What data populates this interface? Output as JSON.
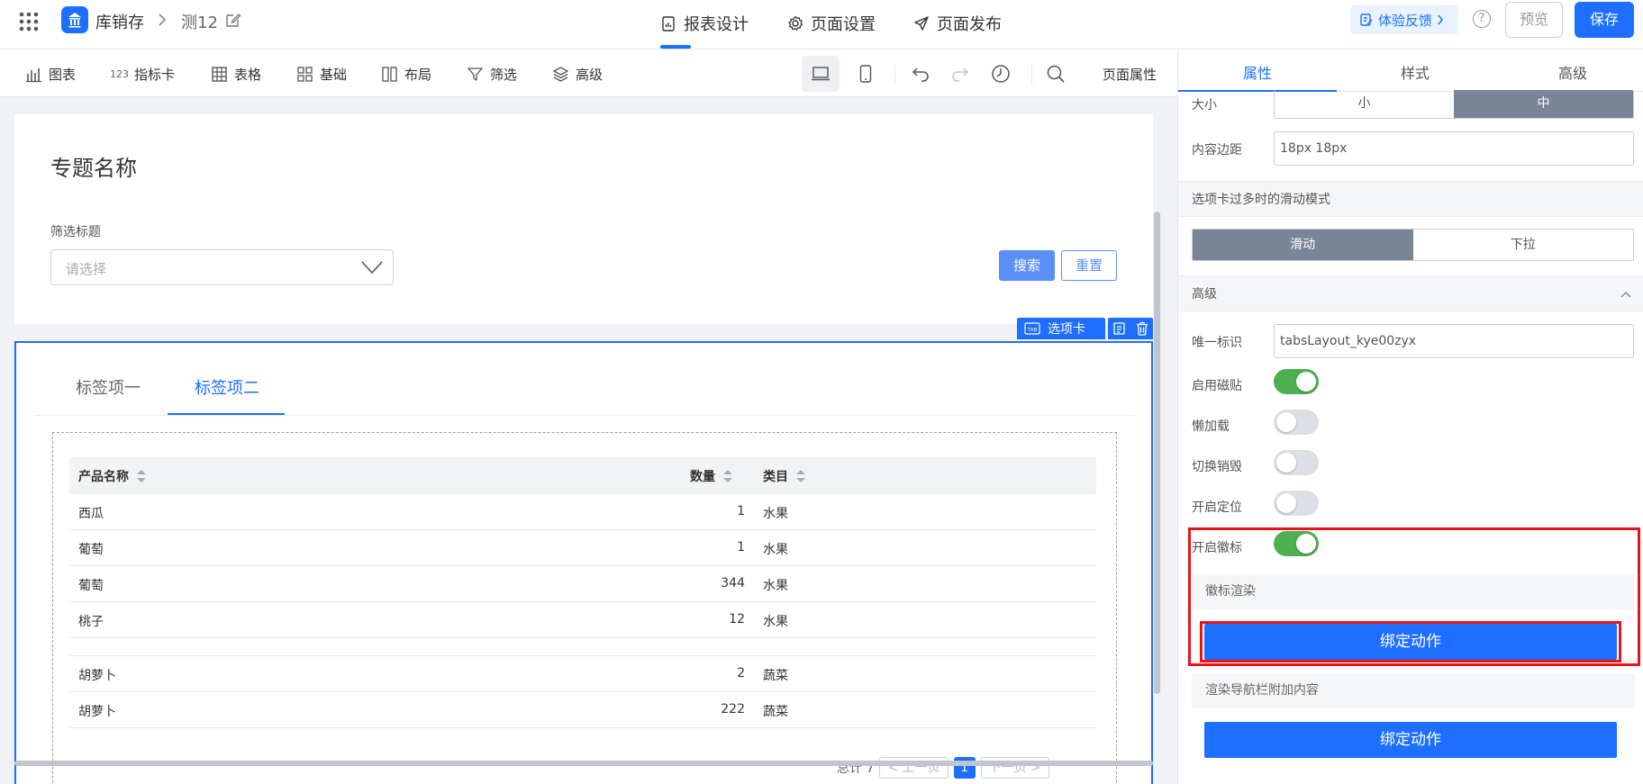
{
  "header": {
    "app_name": "库销存",
    "page_name": "测12",
    "tabs": [
      {
        "label": "报表设计",
        "icon": "report-icon",
        "active": true
      },
      {
        "label": "页面设置",
        "icon": "gear-icon",
        "active": false
      },
      {
        "label": "页面发布",
        "icon": "send-icon",
        "active": false
      }
    ],
    "feedback": "体验反馈",
    "help": "?",
    "preview": "预览",
    "save": "保存",
    "accent": "#1e6fff"
  },
  "toolbar": {
    "items": [
      {
        "label": "图表",
        "icon": "bar-chart-icon"
      },
      {
        "label": "指标卡",
        "icon": "metric-icon"
      },
      {
        "label": "表格",
        "icon": "table-icon"
      },
      {
        "label": "基础",
        "icon": "grid-icon"
      },
      {
        "label": "布局",
        "icon": "layout-icon"
      },
      {
        "label": "筛选",
        "icon": "filter-icon"
      },
      {
        "label": "高级",
        "icon": "layers-icon"
      }
    ],
    "metric_prefix": "123",
    "page_props": "页面属性"
  },
  "canvas": {
    "subject_title": "专题名称",
    "filter_label": "筛选标题",
    "select_placeholder": "请选择",
    "search": "搜索",
    "reset": "重置",
    "tabs_tag": "选项卡",
    "tab_tag_icon": "TAB",
    "tabs": [
      {
        "label": "标签项一",
        "active": false
      },
      {
        "label": "标签项二",
        "active": true
      }
    ],
    "table": {
      "columns": [
        "产品名称",
        "数量",
        "类目"
      ],
      "rows": [
        {
          "name": "西瓜",
          "qty": "1",
          "cat": "水果"
        },
        {
          "name": "葡萄",
          "qty": "1",
          "cat": "水果"
        },
        {
          "name": "葡萄",
          "qty": "344",
          "cat": "水果"
        },
        {
          "name": "桃子",
          "qty": "12",
          "cat": "水果"
        },
        {
          "name": "",
          "qty": "",
          "cat": ""
        },
        {
          "name": "胡萝卜",
          "qty": "2",
          "cat": "蔬菜"
        },
        {
          "name": "胡萝卜",
          "qty": "222",
          "cat": "蔬菜"
        }
      ]
    },
    "pager": {
      "total": "总计 7",
      "prev": "< 上一页",
      "current": "1",
      "next": "下一页 >"
    }
  },
  "rpanel": {
    "tabs": [
      "属性",
      "样式",
      "高级"
    ],
    "size_label": "大小",
    "size_options": [
      "小",
      "中"
    ],
    "padding_label": "内容边距",
    "padding_value": "18px 18px",
    "overflow_section": "选项卡过多时的滑动模式",
    "overflow_options": [
      "滑动",
      "下拉"
    ],
    "advanced_section": "高级",
    "uid_label": "唯一标识",
    "uid_value": "tabsLayout_kye00zyx",
    "toggles": [
      {
        "label": "启用磁贴",
        "on": true
      },
      {
        "label": "懒加载",
        "on": false
      },
      {
        "label": "切换销毁",
        "on": false
      },
      {
        "label": "开启定位",
        "on": false
      },
      {
        "label": "开启徽标",
        "on": true
      }
    ],
    "badge_render": "徽标渲染",
    "bind_action": "绑定动作",
    "nav_extra": "渲染导航栏附加内容",
    "bind_action_2": "绑定动作"
  }
}
